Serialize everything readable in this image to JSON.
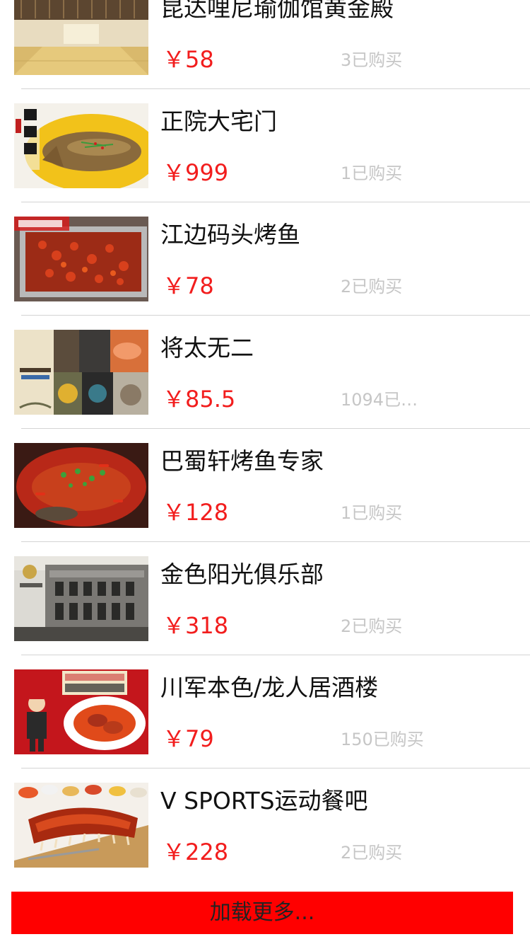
{
  "deals": [
    {
      "title": "昆达哩尼瑜伽馆黄金殿",
      "price": "￥58",
      "sold": "3已购买",
      "image": "yoga-hall-photo"
    },
    {
      "title": "正院大宅门",
      "price": "￥999",
      "sold": "1已购买",
      "image": "braised-fish-photo"
    },
    {
      "title": "江边码头烤鱼",
      "price": "￥78",
      "sold": "2已购买",
      "image": "grilled-fish-tray-photo"
    },
    {
      "title": "将太无二",
      "price": "￥85.5",
      "sold": "1094已…",
      "image": "sushi-collage-photo"
    },
    {
      "title": "巴蜀轩烤鱼专家",
      "price": "￥128",
      "sold": "1已购买",
      "image": "spicy-fish-photo"
    },
    {
      "title": "金色阳光俱乐部",
      "price": "￥318",
      "sold": "2已购买",
      "image": "club-building-photo"
    },
    {
      "title": "川军本色/龙人居酒楼",
      "price": "￥79",
      "sold": "150已购买",
      "image": "restaurant-poster-photo"
    },
    {
      "title": "V SPORTS运动餐吧",
      "price": "￥228",
      "sold": "2已购买",
      "image": "ribs-platter-photo"
    }
  ],
  "load_more_label": "加载更多...",
  "colors": {
    "price": "#f21d1d",
    "sold": "#c6c6c6",
    "load_more_bg": "#ff0000"
  }
}
